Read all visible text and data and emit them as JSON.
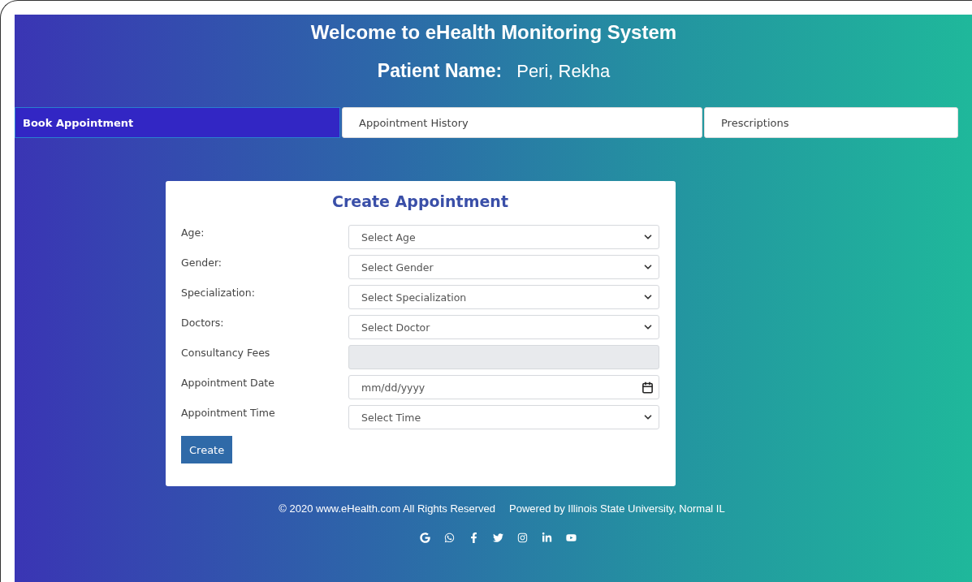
{
  "header": {
    "title": "Welcome to eHealth Monitoring System",
    "patient_label": "Patient Name:",
    "patient_name": "Peri, Rekha"
  },
  "tabs": [
    {
      "label": "Book Appointment",
      "selected": true
    },
    {
      "label": "Appointment History",
      "selected": false
    },
    {
      "label": "Prescriptions",
      "selected": false
    }
  ],
  "form": {
    "title": "Create Appointment",
    "fields": [
      {
        "label": "Age:",
        "kind": "select",
        "placeholder": "Select Age"
      },
      {
        "label": "Gender:",
        "kind": "select",
        "placeholder": "Select Gender"
      },
      {
        "label": "Specialization:",
        "kind": "select",
        "placeholder": "Select Specialization"
      },
      {
        "label": "Doctors:",
        "kind": "select",
        "placeholder": "Select Doctor"
      },
      {
        "label": "Consultancy Fees",
        "kind": "readonly"
      },
      {
        "label": "Appointment Date",
        "kind": "date",
        "placeholder": "mm/dd/yyyy"
      },
      {
        "label": "Appointment Time",
        "kind": "select",
        "placeholder": "Select Time"
      }
    ],
    "submit": "Create"
  },
  "footer": {
    "copyright": "© 2020 www.eHealth.com All Rights Reserved",
    "powered_by": "Powered by Illinois State University, Normal IL",
    "social": [
      {
        "kind": "g"
      },
      {
        "kind": "chat"
      },
      {
        "kind": "f"
      },
      {
        "kind": "bird"
      },
      {
        "kind": "camera"
      },
      {
        "kind": "in"
      },
      {
        "kind": "video"
      }
    ]
  }
}
